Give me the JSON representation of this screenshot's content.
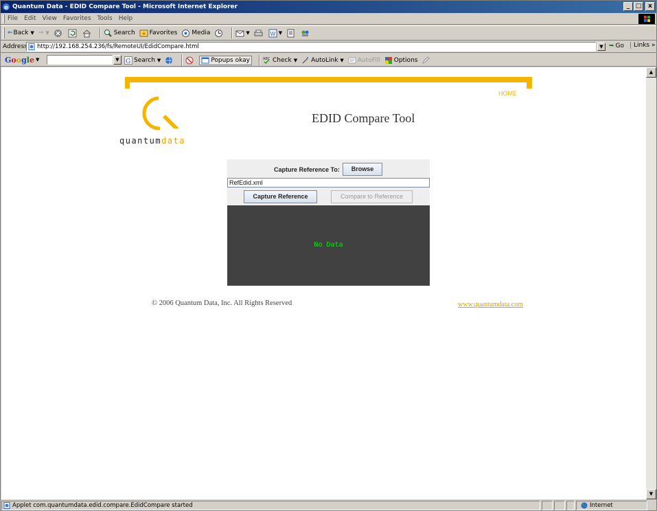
{
  "window": {
    "title": "Quantum Data - EDID Compare Tool - Microsoft Internet Explorer",
    "minimize": "_",
    "maximize": "□",
    "close": "x"
  },
  "menu": [
    "File",
    "Edit",
    "View",
    "Favorites",
    "Tools",
    "Help"
  ],
  "toolbar": {
    "back": "Back",
    "search": "Search",
    "favorites": "Favorites",
    "media": "Media"
  },
  "address": {
    "label": "Address",
    "url": "http://192.168.254.236/fs/RemoteUI/EdidCompare.html",
    "go": "Go",
    "links": "Links"
  },
  "google_bar": {
    "logo": [
      "G",
      "o",
      "o",
      "g",
      "l",
      "e"
    ],
    "search": "Search",
    "popups": "Popups okay",
    "check": "Check",
    "autolink": "AutoLink",
    "autofill": "AutoFill",
    "options": "Options"
  },
  "page": {
    "home_link": "HOME",
    "logo_text_main": "quantum",
    "logo_text_accent": "data",
    "title": "EDID Compare Tool",
    "copyright": "© 2006 Quantum Data, Inc. All Rights Reserved",
    "site_link": "www.quantumdata.com"
  },
  "applet": {
    "capture_label": "Capture Reference To:",
    "browse_label": "Browse",
    "filename": "RefEdid.xml",
    "capture_button": "Capture Reference",
    "compare_button": "Compare to Reference",
    "result_text": "No Data"
  },
  "status": {
    "message": "Applet com.quantumdata.edid.compare.EdidCompare started",
    "zone": "Internet"
  },
  "colors": {
    "brand_accent": "#f5b400",
    "result_bg": "#414141",
    "result_text": "#13e01a",
    "titlebar": "#0a246a"
  }
}
